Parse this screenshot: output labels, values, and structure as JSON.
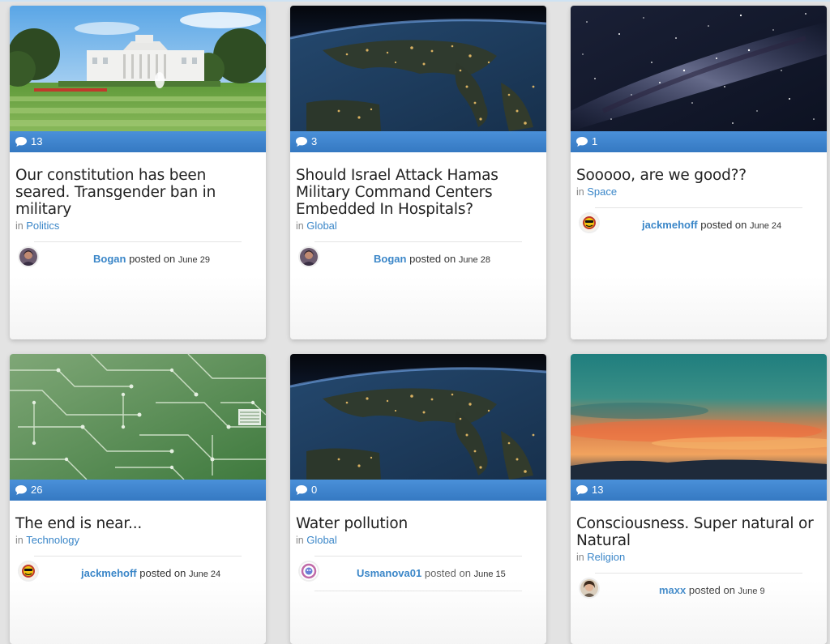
{
  "colors": {
    "accent": "#3a86c8",
    "bar": "#3f84cf"
  },
  "posts": [
    {
      "comments": "13",
      "title": "Our constitution has been seared. Transgender ban in military",
      "in_label": "in",
      "category": "Politics",
      "user": "Bogan",
      "posted_label": "posted on",
      "date": "June 29",
      "image": "white-house"
    },
    {
      "comments": "3",
      "title": "Should Israel Attack Hamas Military Command Centers Embedded In Hospitals?",
      "in_label": "in",
      "category": "Global",
      "user": "Bogan",
      "posted_label": "posted on",
      "date": "June 28",
      "image": "earth-night"
    },
    {
      "comments": "1",
      "title": "Sooooo, are we good??",
      "in_label": "in",
      "category": "Space",
      "user": "jackmehoff",
      "posted_label": "posted on",
      "date": "June 24",
      "image": "milky-way"
    },
    {
      "comments": "26",
      "title": "The end is near...",
      "in_label": "in",
      "category": "Technology",
      "user": "jackmehoff",
      "posted_label": "posted on",
      "date": "June 24",
      "image": "circuit-board"
    },
    {
      "comments": "0",
      "title": "Water pollution",
      "in_label": "in",
      "category": "Global",
      "user": "Usmanova01",
      "posted_label": "posted on",
      "date": "June 15",
      "image": "earth-night"
    },
    {
      "comments": "13",
      "title": "Consciousness. Super natural or Natural",
      "in_label": "in",
      "category": "Religion",
      "user": "maxx",
      "posted_label": "posted on",
      "date": "June 9",
      "image": "sunset"
    }
  ]
}
